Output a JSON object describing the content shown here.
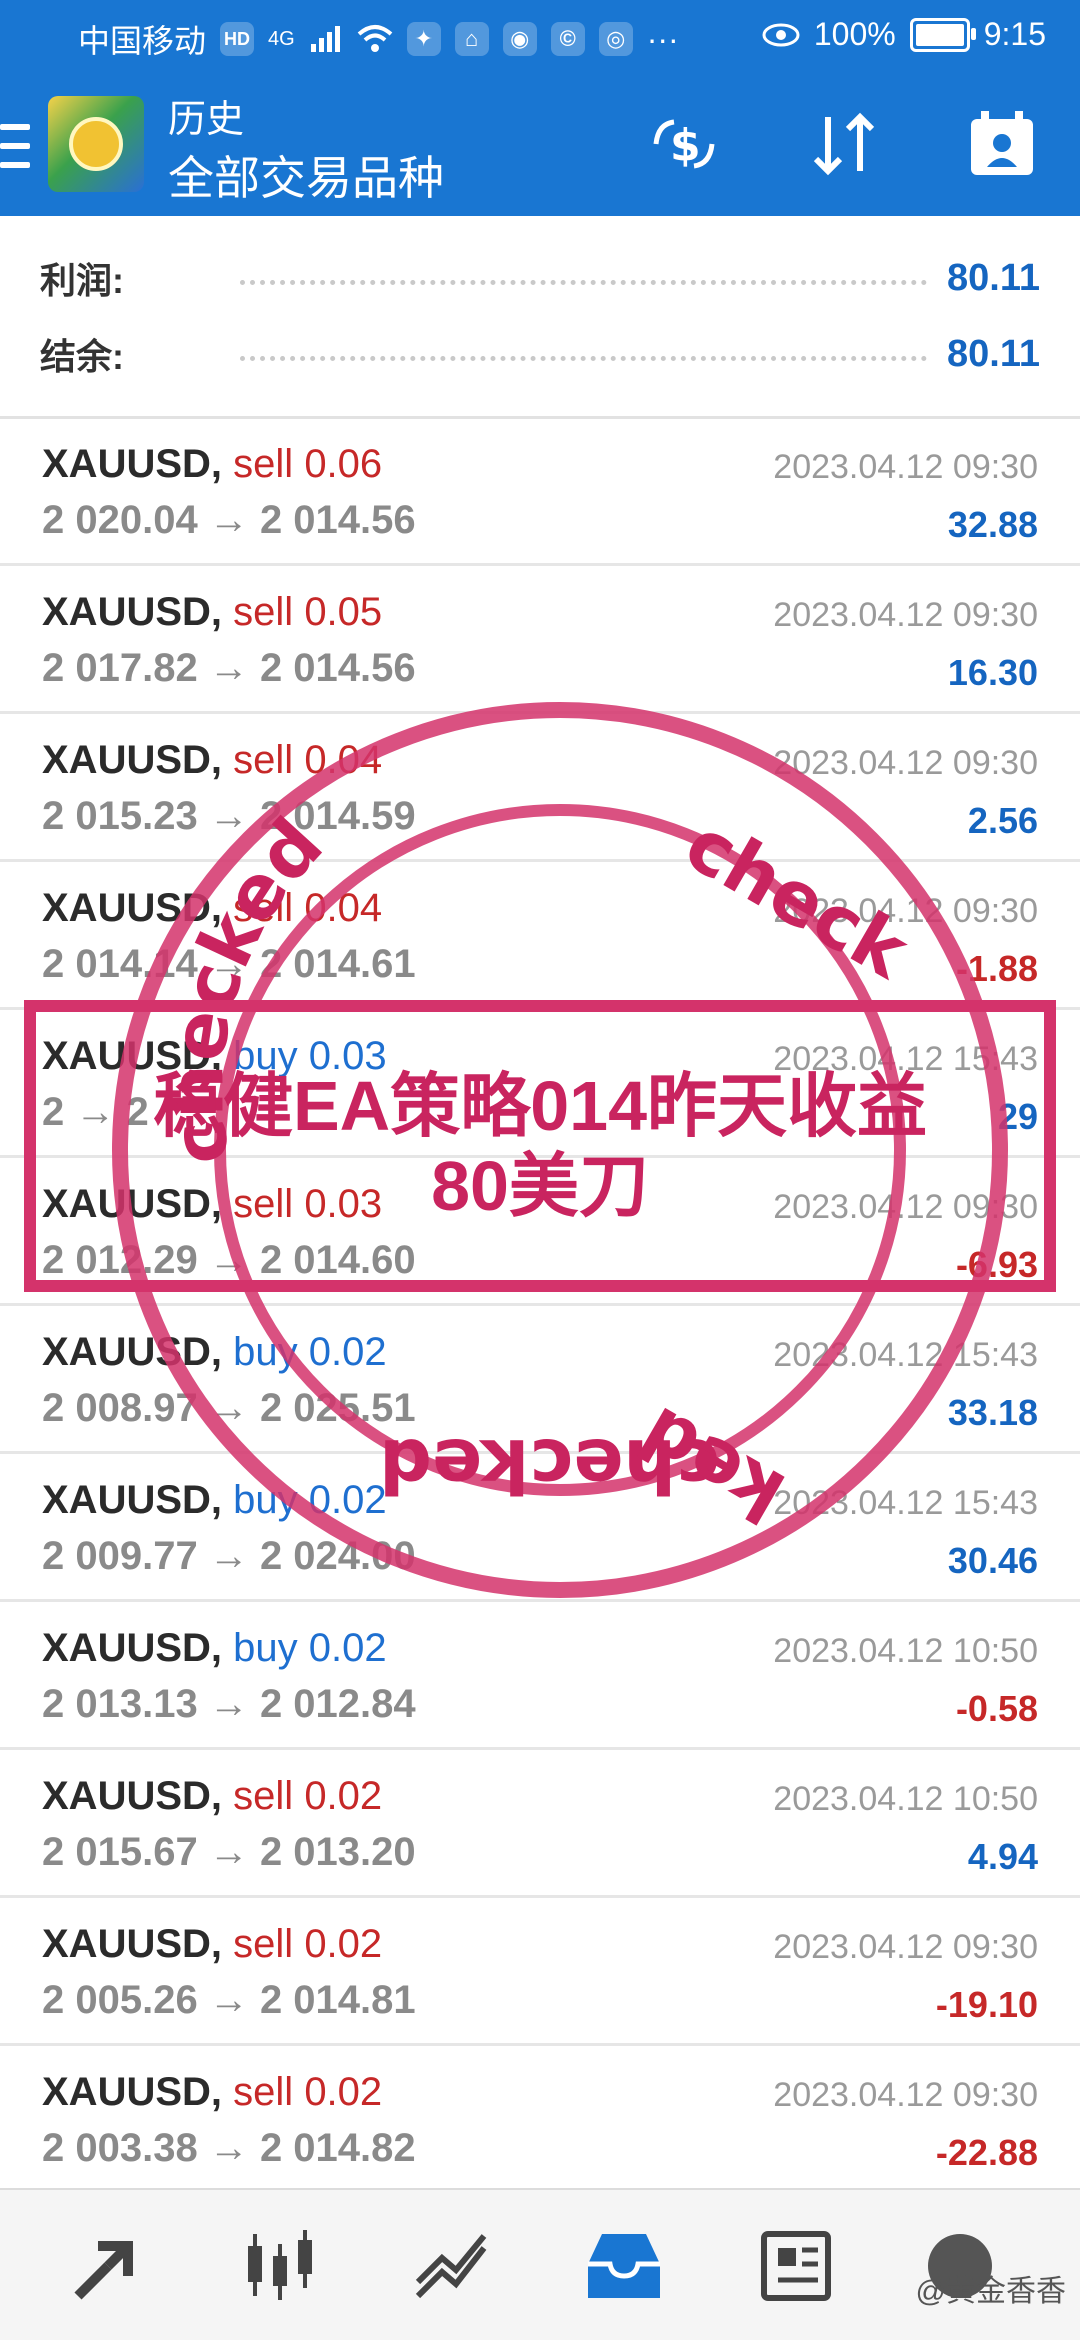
{
  "status_bar": {
    "carrier": "中国移动",
    "hd": "HD",
    "network": "4G",
    "battery": "100%",
    "time": "9:15"
  },
  "header": {
    "subtitle": "历史",
    "title": "全部交易品种"
  },
  "summary": {
    "profit_label": "利润:",
    "profit_value": "80.11",
    "balance_label": "结余:",
    "balance_value": "80.11"
  },
  "trades": [
    {
      "symbol": "XAUUSD,",
      "side": "sell",
      "volume": "0.06",
      "open": "2 020.04",
      "close": "2 014.56",
      "time": "2023.04.12 09:30",
      "profit": "32.88"
    },
    {
      "symbol": "XAUUSD,",
      "side": "sell",
      "volume": "0.05",
      "open": "2 017.82",
      "close": "2 014.56",
      "time": "2023.04.12 09:30",
      "profit": "16.30"
    },
    {
      "symbol": "XAUUSD,",
      "side": "sell",
      "volume": "0.04",
      "open": "2 015.23",
      "close": "2 014.59",
      "time": "2023.04.12 09:30",
      "profit": "2.56"
    },
    {
      "symbol": "XAUUSD,",
      "side": "sell",
      "volume": "0.04",
      "open": "2 014.14",
      "close": "2 014.61",
      "time": "2023.04.12 09:30",
      "profit": "-1.88"
    },
    {
      "symbol": "XAUUSD,",
      "side": "buy",
      "volume": "0.03",
      "open": "2 ",
      "close": "2 ",
      "time": "2023.04.12 15:43",
      "profit": "29"
    },
    {
      "symbol": "XAUUSD,",
      "side": "sell",
      "volume": "0.03",
      "open": "2 012.29",
      "close": "2 014.60",
      "time": "2023.04.12 09:30",
      "profit": "-6.93"
    },
    {
      "symbol": "XAUUSD,",
      "side": "buy",
      "volume": "0.02",
      "open": "2 008.97",
      "close": "2 025.51",
      "time": "2023.04.12 15:43",
      "profit": "33.18"
    },
    {
      "symbol": "XAUUSD,",
      "side": "buy",
      "volume": "0.02",
      "open": "2 009.77",
      "close": "2 024.00",
      "time": "2023.04.12 15:43",
      "profit": "30.46"
    },
    {
      "symbol": "XAUUSD,",
      "side": "buy",
      "volume": "0.02",
      "open": "2 013.13",
      "close": "2 012.84",
      "time": "2023.04.12 10:50",
      "profit": "-0.58"
    },
    {
      "symbol": "XAUUSD,",
      "side": "sell",
      "volume": "0.02",
      "open": "2 015.67",
      "close": "2 013.20",
      "time": "2023.04.12 10:50",
      "profit": "4.94"
    },
    {
      "symbol": "XAUUSD,",
      "side": "sell",
      "volume": "0.02",
      "open": "2 005.26",
      "close": "2 014.81",
      "time": "2023.04.12 09:30",
      "profit": "-19.10"
    },
    {
      "symbol": "XAUUSD,",
      "side": "sell",
      "volume": "0.02",
      "open": "2 003.38",
      "close": "2 014.82",
      "time": "2023.04.12 09:30",
      "profit": "-22.88"
    }
  ],
  "stamp": {
    "text_top": "checked",
    "text_right": "check",
    "text_bottom": "checked",
    "text_left": "ked",
    "banner_line1": "稳健EA策略014昨天收益",
    "banner_line2": "80美刀"
  },
  "bottom_nav": {
    "items": [
      "quotes-icon",
      "chart-icon",
      "trade-icon",
      "history-icon",
      "news-icon",
      "chat-icon"
    ],
    "watermark": "@黄金香香"
  },
  "colors": {
    "accent": "#1976d2",
    "positive": "#1565c0",
    "negative": "#c62828",
    "stamp": "#d4336b"
  }
}
